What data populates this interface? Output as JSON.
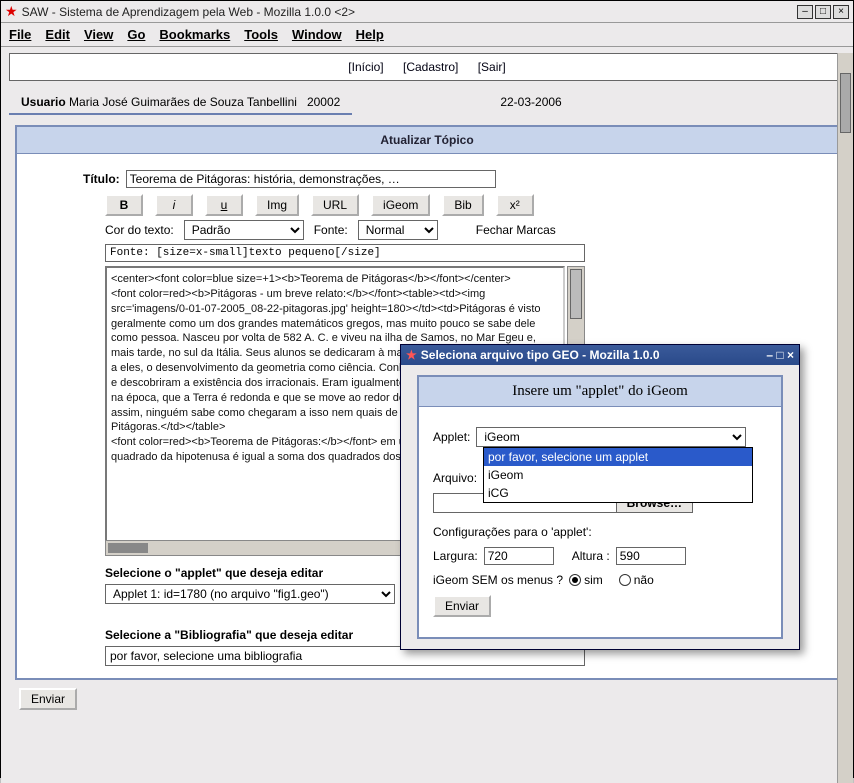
{
  "main_window": {
    "title": "SAW - Sistema de Aprendizagem pela Web - Mozilla 1.0.0 <2>",
    "menubar": [
      "File",
      "Edit",
      "View",
      "Go",
      "Bookmarks",
      "Tools",
      "Window",
      "Help"
    ],
    "nav": {
      "inicio": "[Início]",
      "cadastro": "[Cadastro]",
      "sair": "[Sair]"
    },
    "user_label": "Usuario",
    "user_name": "Maria José Guimarães de Souza Tanbellini",
    "user_id": "20002",
    "date": "22-03-2006",
    "panel_title": "Atualizar Tópico",
    "titulo_label": "Título:",
    "titulo_value": "Teorema de Pitágoras: história, demonstrações, …",
    "toolbar": {
      "b": "B",
      "i": "i",
      "u": "u",
      "img": "Img",
      "url": "URL",
      "igeom": "iGeom",
      "bib": "Bib",
      "x2": "x²"
    },
    "cor_label": "Cor do texto:",
    "cor_value": "Padrão",
    "fonte_label": "Fonte:",
    "fonte_value": "Normal",
    "fechar": "Fechar Marcas",
    "srcline": "Fonte: [size=x-small]texto pequeno[/size]",
    "textarea": "<center><font color=blue size=+1><b>Teorema de Pitágoras</b></font></center>\n<font color=red><b>Pitágoras - um breve relato:</b></font><table><td><img src='imagens/0-01-07-2005_08-22-pitagoras.jpg' height=180></td><td>Pitágoras é visto geralmente como um dos grandes matemáticos gregos, mas muito pouco se sabe dele como pessoa. Nasceu por volta de 582 A. C. e viveu na ilha de Samos, no Mar Egeu e, mais tarde, no sul da Itália. Seus alunos se dedicaram à matemática, astronomia e, graças a eles, o desenvolvimento da geometria como ciência. Conheciam o Teorema de Pitágoras e descobriram a existência dos irracionais. Eram igualmente bons em astronomia: sabiam, na época, que a Terra é redonda e que se move ao redor do sol. Não deixaram escritos e, assim, ninguém sabe como chegaram a isso nem quais de suas descobertas são devidas a Pitágoras.</td></table>\n<font color=red><b>Teorema de Pitágoras:</b></font> em um triângulo retângulo, o quadrado da hipotenusa é igual a soma dos quadrados dos catetos.",
    "applet_section": "Selecione o \"applet\" que deseja editar",
    "applet_select_value": "Applet 1: id=1780 (no arquivo \"fig1.geo\")",
    "bib_section": "Selecione a \"Bibliografia\" que deseja editar",
    "bib_value": "por favor, selecione uma bibliografia",
    "enviar": "Enviar"
  },
  "popup": {
    "title": "Seleciona arquivo tipo GEO - Mozilla 1.0.0",
    "panel_title": "Insere um \"applet\" do iGeom",
    "applet_label": "Applet:",
    "applet_value": "iGeom",
    "dropdown": {
      "hint": "por favor, selecione um applet",
      "options": [
        "iGeom",
        "iCG"
      ]
    },
    "arquivo_label": "Arquivo:",
    "browse": "Browse…",
    "config_label": "Configurações para o 'applet':",
    "largura_label": "Largura:",
    "largura_value": "720",
    "altura_label": "Altura :",
    "altura_value": "590",
    "menus_label": "iGeom SEM os menus ?",
    "sim": "sim",
    "nao": "não",
    "enviar": "Enviar"
  }
}
